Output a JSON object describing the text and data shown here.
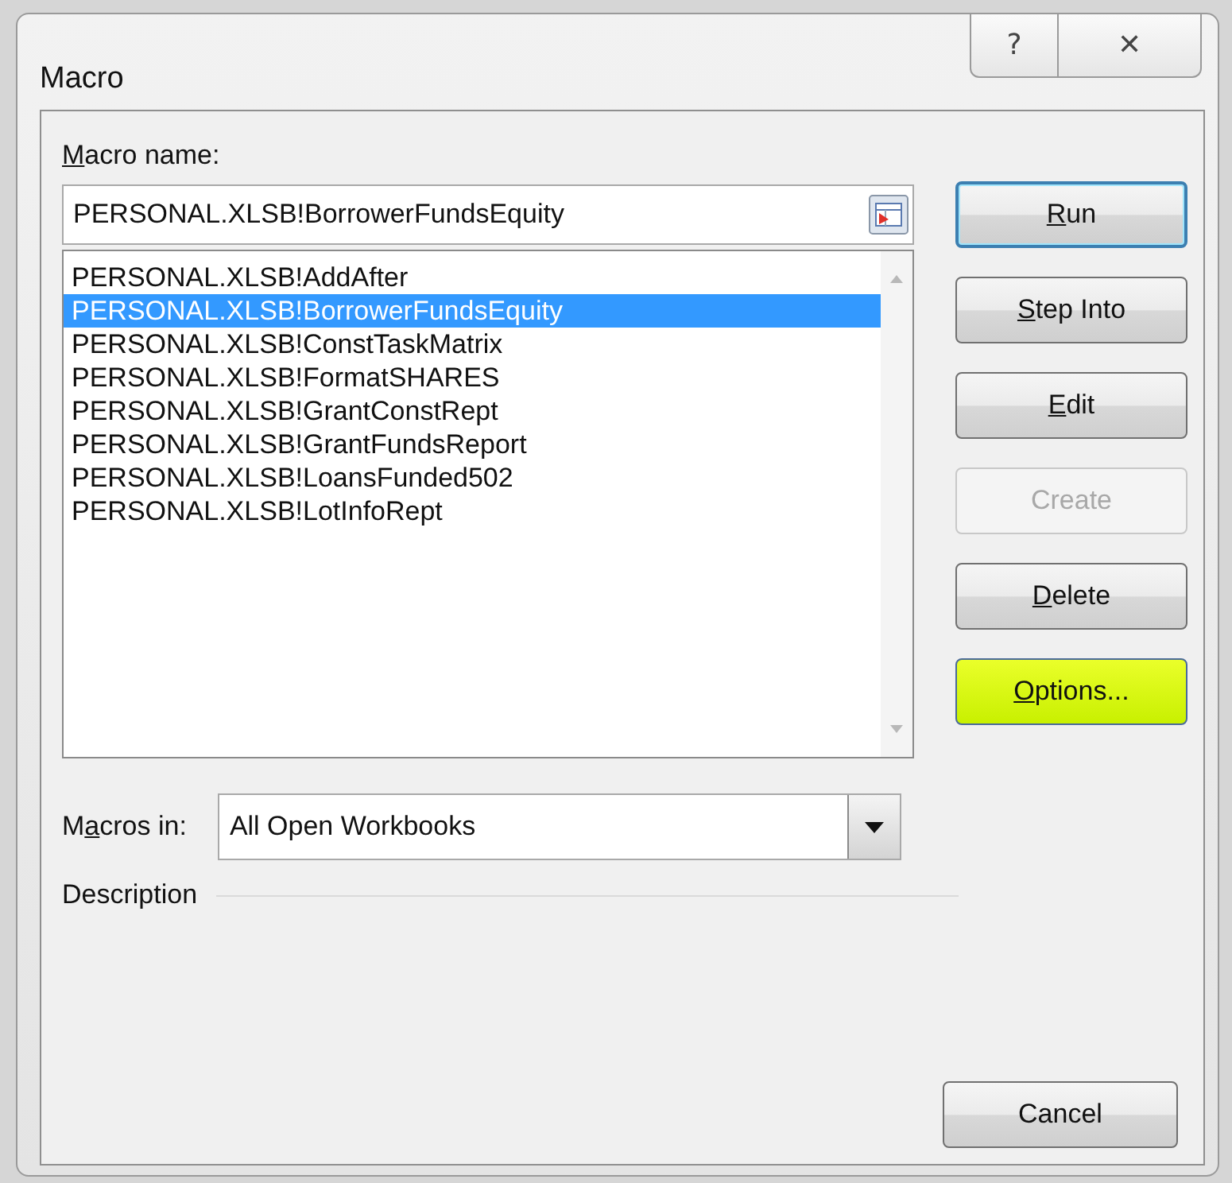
{
  "window": {
    "title": "Macro",
    "help_button": "?",
    "close_button": "✕"
  },
  "macro_name": {
    "label": {
      "key": "M",
      "post": "acro name:"
    },
    "value": "PERSONAL.XLSB!BorrowerFundsEquity"
  },
  "macros": [
    {
      "label": "PERSONAL.XLSB!AddAfter",
      "selected": false
    },
    {
      "label": "PERSONAL.XLSB!BorrowerFundsEquity",
      "selected": true
    },
    {
      "label": "PERSONAL.XLSB!ConstTaskMatrix",
      "selected": false
    },
    {
      "label": "PERSONAL.XLSB!FormatSHARES",
      "selected": false
    },
    {
      "label": "PERSONAL.XLSB!GrantConstRept",
      "selected": false
    },
    {
      "label": "PERSONAL.XLSB!GrantFundsReport",
      "selected": false
    },
    {
      "label": "PERSONAL.XLSB!LoansFunded502",
      "selected": false
    },
    {
      "label": "PERSONAL.XLSB!LotInfoRept",
      "selected": false
    }
  ],
  "buttons": [
    {
      "key": "R",
      "post": "un",
      "default": true,
      "disabled": false,
      "highlighted": false
    },
    {
      "key": "S",
      "post": "tep Into",
      "default": false,
      "disabled": false,
      "highlighted": false
    },
    {
      "key": "E",
      "post": "dit",
      "default": false,
      "disabled": false,
      "highlighted": false
    },
    {
      "pre": "Create",
      "default": false,
      "disabled": true,
      "highlighted": false
    },
    {
      "key": "D",
      "post": "elete",
      "default": false,
      "disabled": false,
      "highlighted": false
    },
    {
      "key": "O",
      "post": "ptions...",
      "default": false,
      "disabled": false,
      "highlighted": true
    }
  ],
  "macros_in": {
    "label": {
      "pre": "M",
      "key": "a",
      "post": "cros in:"
    },
    "value": "All Open Workbooks"
  },
  "description": {
    "label": "Description"
  },
  "cancel_button": "Cancel"
}
